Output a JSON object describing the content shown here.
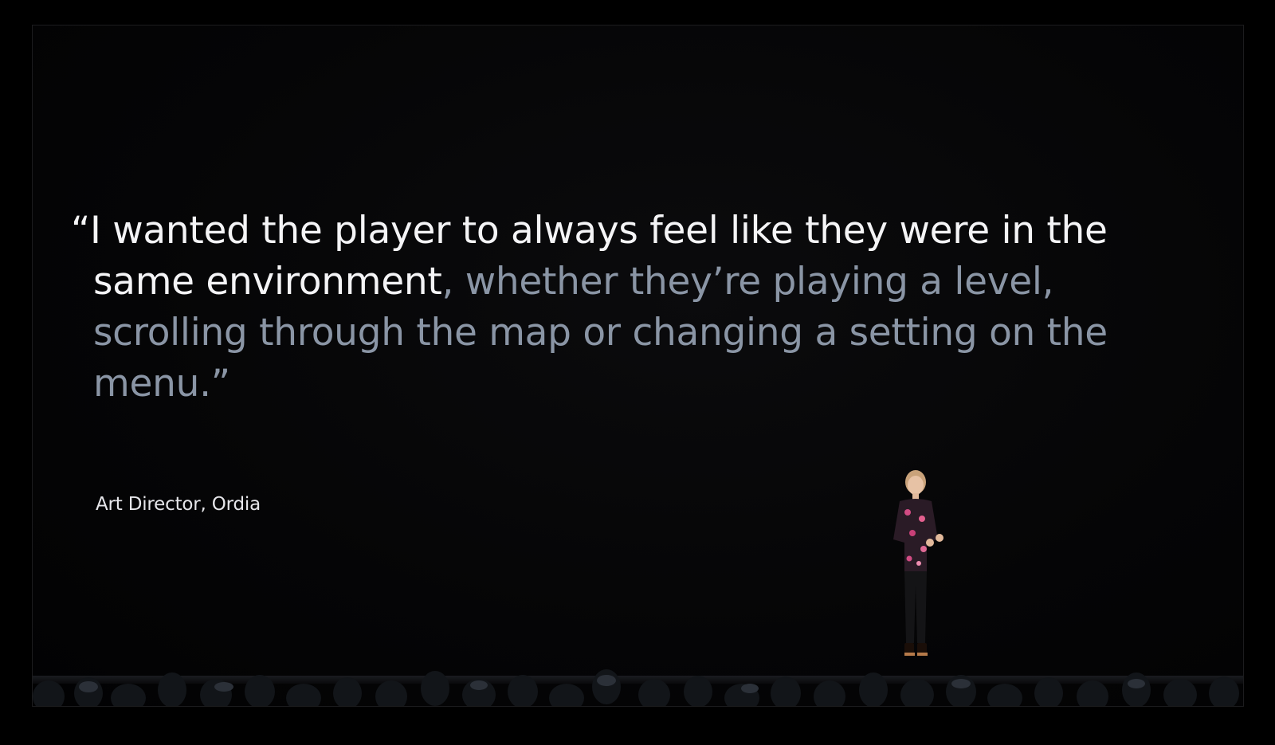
{
  "slide": {
    "quote_bright": "“I wanted the player to always feel like they were in the same environment",
    "quote_dim": ", whether they’re playing a level, scrolling through the map or changing a setting on the menu.”",
    "attribution": "Art Director, Ordia"
  },
  "colors": {
    "background": "#000000",
    "quote_bright": "#f4f4f6",
    "quote_dim": "#8a95a5"
  }
}
